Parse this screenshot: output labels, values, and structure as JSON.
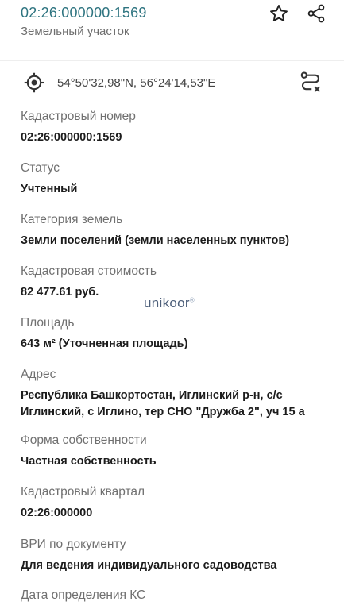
{
  "header": {
    "title": "02:26:000000:1569",
    "subtitle": "Земельный участок"
  },
  "coordinates": "54°50'32,98\"N, 56°24'14,53\"E",
  "fields": [
    {
      "label": "Кадастровый номер",
      "value": "02:26:000000:1569"
    },
    {
      "label": "Статус",
      "value": "Учтенный"
    },
    {
      "label": "Категория земель",
      "value": "Земли поселений (земли населенных пунктов)"
    },
    {
      "label": "Кадастровая стоимость",
      "value": "82 477.61 руб."
    },
    {
      "label": "Площадь",
      "value": "643 м² (Уточненная площадь)"
    },
    {
      "label": "Адрес",
      "value_lines": [
        "Республика Башкортостан, Иглинский р-н, с/с",
        "Иглинский, с Иглино, тер СНО \"Дружба 2\", уч 15 а"
      ]
    },
    {
      "label": "Форма собственности",
      "value": "Частная собственность"
    },
    {
      "label": "Кадастровый квартал",
      "value": "02:26:000000"
    },
    {
      "label": "ВРИ по документу",
      "value": "Для ведения индивидуального садоводства"
    },
    {
      "label": "Дата определения КС"
    }
  ],
  "watermark": {
    "text": "unikoor",
    "mark": "®"
  },
  "icons": {
    "star": "star-outline-icon",
    "share": "share-icon",
    "locate": "crosshair-locate-icon",
    "route": "route-icon"
  },
  "colors": {
    "title": "#2e7480",
    "label": "#707070",
    "value": "#1c1c1c"
  }
}
